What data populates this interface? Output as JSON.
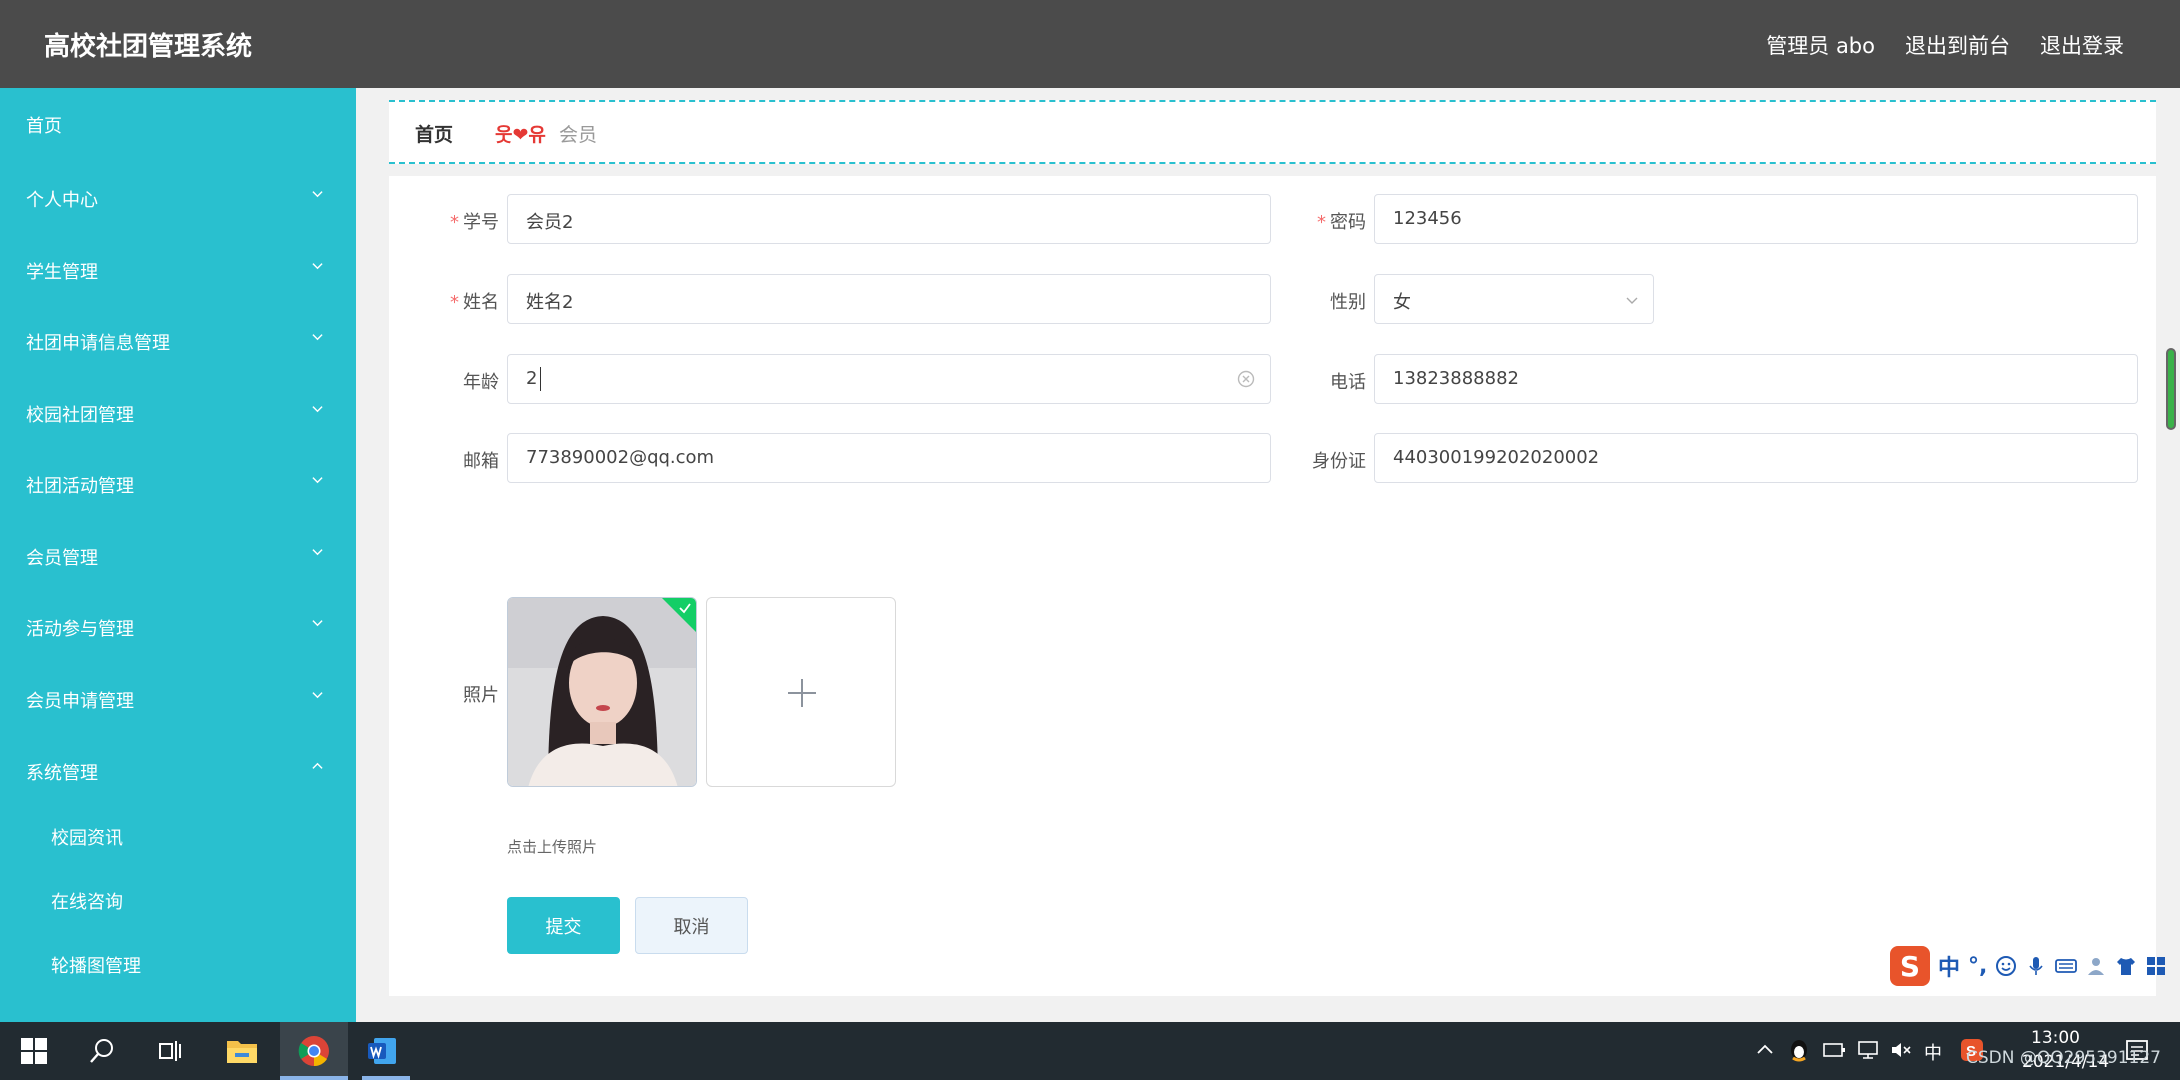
{
  "header": {
    "title": "高校社团管理系统",
    "admin_label": "管理员 abo",
    "to_front": "退出到前台",
    "logout": "退出登录"
  },
  "sidebar": {
    "items": [
      {
        "label": "首页",
        "expandable": false
      },
      {
        "label": "个人中心",
        "expandable": true
      },
      {
        "label": "学生管理",
        "expandable": true
      },
      {
        "label": "社团申请信息管理",
        "expandable": true
      },
      {
        "label": "校园社团管理",
        "expandable": true
      },
      {
        "label": "社团活动管理",
        "expandable": true
      },
      {
        "label": "会员管理",
        "expandable": true
      },
      {
        "label": "活动参与管理",
        "expandable": true
      },
      {
        "label": "会员申请管理",
        "expandable": true
      },
      {
        "label": "系统管理",
        "expandable": true,
        "expanded": true
      }
    ],
    "subitems": [
      {
        "label": "校园资讯"
      },
      {
        "label": "在线咨询"
      },
      {
        "label": "轮播图管理"
      }
    ]
  },
  "breadcrumb": {
    "home": "首页",
    "separator": "웃❤유",
    "current": "会员"
  },
  "form": {
    "student_id": {
      "label": "学号",
      "required": true,
      "value": "会员2"
    },
    "password": {
      "label": "密码",
      "required": true,
      "value": "123456"
    },
    "name": {
      "label": "姓名",
      "required": true,
      "value": "姓名2"
    },
    "gender": {
      "label": "性别",
      "value": "女"
    },
    "age": {
      "label": "年龄",
      "value": "2"
    },
    "phone": {
      "label": "电话",
      "value": "13823888882"
    },
    "email": {
      "label": "邮箱",
      "value": "773890002@qq.com"
    },
    "id_card": {
      "label": "身份证",
      "value": "440300199202020002"
    },
    "photo": {
      "label": "照片",
      "tip": "点击上传照片"
    },
    "submit_label": "提交",
    "cancel_label": "取消"
  },
  "ime": {
    "mode": "中",
    "punct": "°,"
  },
  "taskbar": {
    "time": "13:00",
    "date": "2021/4/14",
    "tray_lang": "中"
  },
  "watermark": "CSDN @QQ295391127",
  "colors": {
    "header_bg": "#4b4b4b",
    "sidebar_bg": "#29c0cf",
    "accent": "#29c0cf",
    "required": "#f56c6c",
    "check": "#13ce66"
  }
}
